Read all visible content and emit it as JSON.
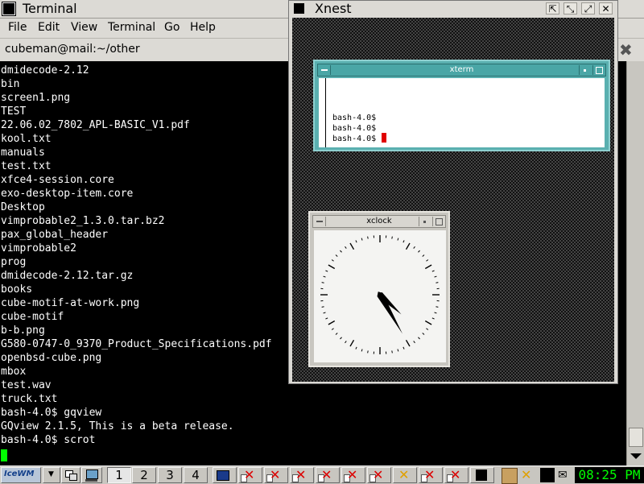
{
  "terminal": {
    "title": "Terminal",
    "menus": [
      "File",
      "Edit",
      "View",
      "Terminal",
      "Go",
      "Help"
    ],
    "tab_label": "cubeman@mail:~/other",
    "tab_close": "✖",
    "lines": [
      "dmidecode-2.12",
      "bin",
      "screen1.png",
      "TEST",
      "22.06.02_7802_APL-BASIC_V1.pdf",
      "kool.txt",
      "manuals",
      "test.txt",
      "xfce4-session.core",
      "exo-desktop-item.core",
      "Desktop",
      "vimprobable2_1.3.0.tar.bz2",
      "pax_global_header",
      "vimprobable2",
      "prog",
      "dmidecode-2.12.tar.gz",
      "books",
      "cube-motif-at-work.png",
      "cube-motif",
      "b-b.png",
      "G580-0747-0_9370_Product_Specifications.pdf",
      "openbsd-cube.png",
      "mbox",
      "test.wav",
      "truck.txt",
      "bash-4.0$ gqview",
      "GQview 2.1.5, This is a beta release.",
      "bash-4.0$ scrot"
    ]
  },
  "xnest": {
    "title": "Xnest",
    "buttons": [
      "⇱",
      "⤡",
      "⤢",
      "✕"
    ],
    "xterm": {
      "title": "xterm",
      "lines": [
        "bash-4.0$",
        "bash-4.0$",
        "bash-4.0$"
      ]
    },
    "xclock": {
      "title": "xclock",
      "time": "4:25"
    }
  },
  "taskbar": {
    "start_label": "IceWM",
    "workspaces": [
      "1",
      "2",
      "3",
      "4"
    ],
    "active_workspace": "1",
    "clock": "08:25 PM",
    "colors": {
      "clock_fg": "#00ff00",
      "close_x": "#dd0000"
    }
  }
}
